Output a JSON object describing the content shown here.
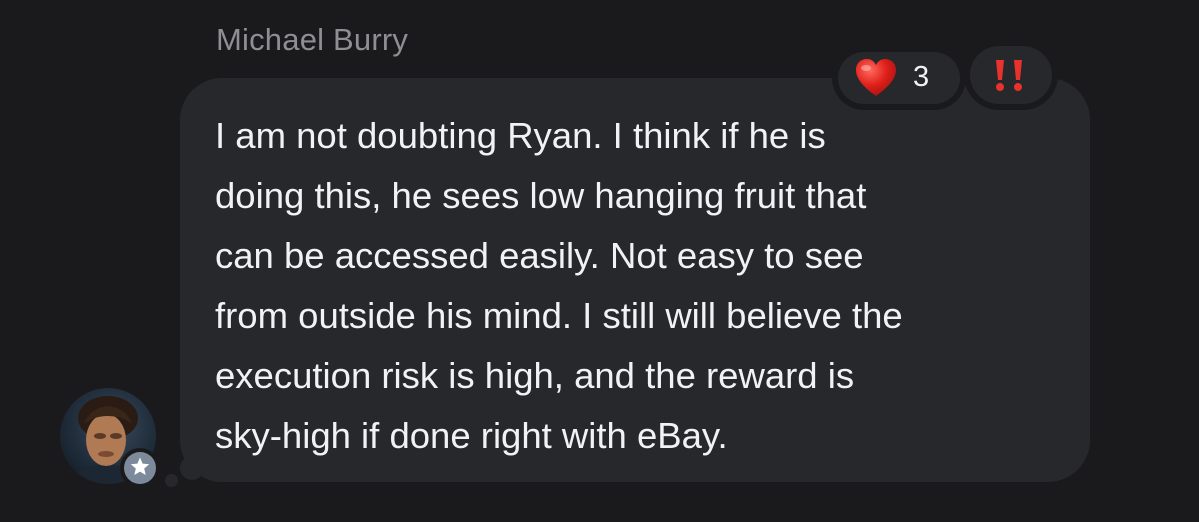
{
  "conversation": {
    "sender_name": "Michael Burry"
  },
  "message": {
    "lines": [
      "I am not doubting Ryan. I think if he is",
      "doing this, he sees low hanging fruit that",
      "can be accessed easily. Not easy to see",
      "from outside his mind. I still will believe the",
      "execution risk is high, and the reward is",
      "sky-high if done right with eBay."
    ]
  },
  "reactions": {
    "heart": {
      "icon": "heart-icon",
      "count": "3",
      "color": "#e0201b"
    },
    "tapback": {
      "icon": "double-exclamation-icon",
      "color": "#e8322b"
    }
  },
  "avatar": {
    "badge_icon": "star-icon"
  },
  "colors": {
    "background": "#1a1a1c",
    "bubble": "#26282b",
    "text": "#f2f2f4",
    "sender": "#8e8e93",
    "badge": "#7d8a9b"
  }
}
